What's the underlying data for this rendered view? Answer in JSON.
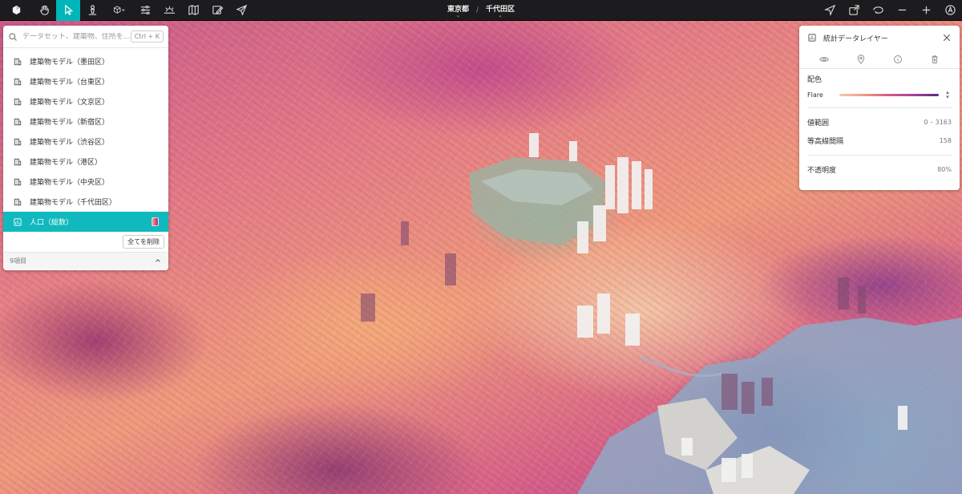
{
  "toolbar": {
    "tools": [
      {
        "name": "logo",
        "icon": "app-logo-icon"
      },
      {
        "name": "hand",
        "icon": "hand-icon"
      },
      {
        "name": "select",
        "icon": "cursor-arrow-icon"
      },
      {
        "name": "pedestrian",
        "icon": "person-pin-icon"
      },
      {
        "name": "cube",
        "icon": "cube-icon"
      },
      {
        "name": "sliders",
        "icon": "sliders-icon"
      },
      {
        "name": "sun",
        "icon": "sun-horizon-icon"
      },
      {
        "name": "map",
        "icon": "map-icon"
      },
      {
        "name": "edit",
        "icon": "edit-panel-icon"
      },
      {
        "name": "share",
        "icon": "paper-plane-icon"
      }
    ],
    "breadcrumb": {
      "prefecture": "東京都",
      "separator": "/",
      "ward": "千代田区"
    },
    "right_tools": [
      {
        "name": "navigate",
        "icon": "location-arrow-icon"
      },
      {
        "name": "export",
        "icon": "export-icon"
      },
      {
        "name": "rotate",
        "icon": "rotate-icon"
      },
      {
        "name": "zoom-out",
        "icon": "minus-icon"
      },
      {
        "name": "zoom-in",
        "icon": "plus-icon"
      },
      {
        "name": "account",
        "icon": "account-icon"
      }
    ]
  },
  "layers_panel": {
    "search_placeholder": "データセット、建築物、住所を...",
    "shortcut": "Ctrl + K",
    "items": [
      {
        "label": "建築物モデル（墨田区）",
        "icon": "building-layer-icon",
        "selected": false
      },
      {
        "label": "建築物モデル（台東区）",
        "icon": "building-layer-icon",
        "selected": false
      },
      {
        "label": "建築物モデル（文京区）",
        "icon": "building-layer-icon",
        "selected": false
      },
      {
        "label": "建築物モデル（新宿区）",
        "icon": "building-layer-icon",
        "selected": false
      },
      {
        "label": "建築物モデル（渋谷区）",
        "icon": "building-layer-icon",
        "selected": false
      },
      {
        "label": "建築物モデル（港区）",
        "icon": "building-layer-icon",
        "selected": false
      },
      {
        "label": "建築物モデル（中央区）",
        "icon": "building-layer-icon",
        "selected": false
      },
      {
        "label": "建築物モデル（千代田区）",
        "icon": "building-layer-icon",
        "selected": false
      },
      {
        "label": "人口（総数）",
        "icon": "stats-layer-icon",
        "selected": true
      }
    ],
    "remove_all_label": "全てを削除",
    "count_label": "9項目"
  },
  "inspector": {
    "title": "統計データレイヤー",
    "color_section_title": "配色",
    "ramp_name": "Flare",
    "value_range_label": "値範囲",
    "value_range": "0 – 3163",
    "contour_interval_label": "等高線間隔",
    "contour_interval": "158",
    "opacity_label": "不透明度",
    "opacity": "80%"
  },
  "colors": {
    "accent": "#00b6bb",
    "toolbar_bg": "#1c1c1e",
    "water": "#8aa7c4"
  }
}
